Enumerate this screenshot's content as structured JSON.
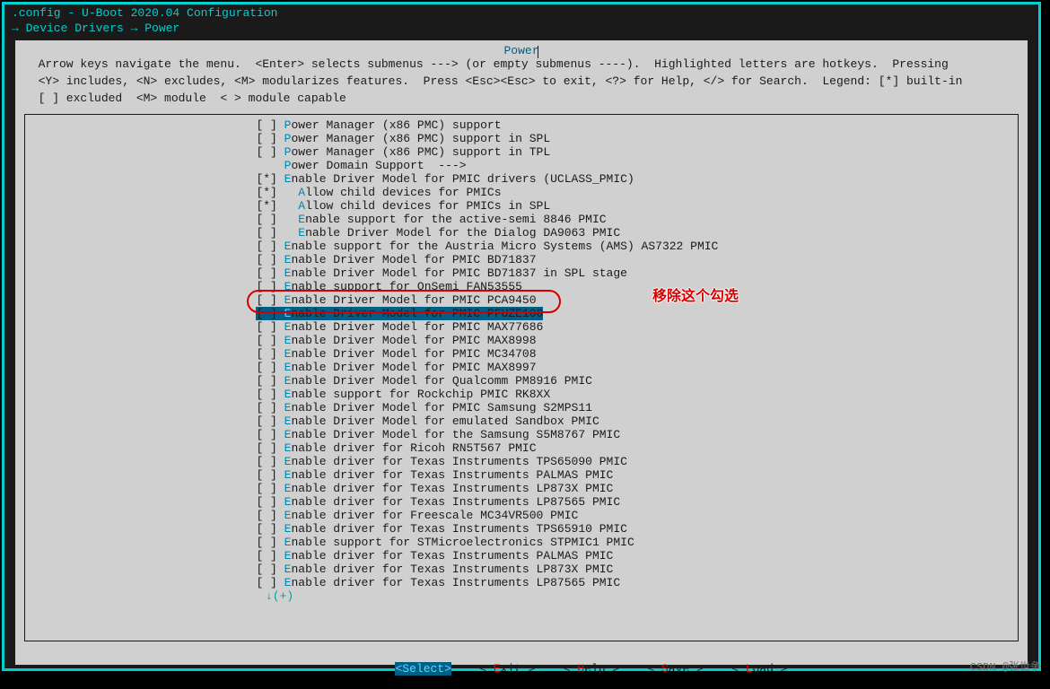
{
  "title": ".config - U-Boot 2020.04 Configuration",
  "breadcrumb": "→ Device Drivers → Power",
  "section_title": "Power",
  "help_lines": [
    "  Arrow keys navigate the menu.  <Enter> selects submenus ---> (or empty submenus ----).  Highlighted letters are hotkeys.  Pressing",
    "  <Y> includes, <N> excludes, <M> modularizes features.  Press <Esc><Esc> to exit, <?> for Help, </> for Search.  Legend: [*] built-in",
    "  [ ] excluded  <M> module  < > module capable"
  ],
  "pad": "                                 ",
  "items": [
    {
      "mark": "[ ]",
      "indent": 0,
      "hot": "P",
      "rest": "ower Manager (x86 PMC) support"
    },
    {
      "mark": "[ ]",
      "indent": 0,
      "hot": "P",
      "rest": "ower Manager (x86 PMC) support in SPL"
    },
    {
      "mark": "[ ]",
      "indent": 0,
      "hot": "P",
      "rest": "ower Manager (x86 PMC) support in TPL"
    },
    {
      "mark": "   ",
      "indent": 0,
      "hot": "P",
      "rest": "ower Domain Support  --->"
    },
    {
      "mark": "[*]",
      "indent": 0,
      "hot": "E",
      "rest": "nable Driver Model for PMIC drivers (UCLASS_PMIC)"
    },
    {
      "mark": "[*]",
      "indent": 1,
      "hot": "A",
      "rest": "llow child devices for PMICs"
    },
    {
      "mark": "[*]",
      "indent": 1,
      "hot": "A",
      "rest": "llow child devices for PMICs in SPL"
    },
    {
      "mark": "[ ]",
      "indent": 1,
      "hot": "E",
      "rest": "nable support for the active-semi 8846 PMIC"
    },
    {
      "mark": "[ ]",
      "indent": 1,
      "hot": "E",
      "rest": "nable Driver Model for the Dialog DA9063 PMIC"
    },
    {
      "mark": "[ ]",
      "indent": 0,
      "hot": "E",
      "rest": "nable support for the Austria Micro Systems (AMS) AS7322 PMIC"
    },
    {
      "mark": "[ ]",
      "indent": 0,
      "hot": "E",
      "rest": "nable Driver Model for PMIC BD71837"
    },
    {
      "mark": "[ ]",
      "indent": 0,
      "hot": "E",
      "rest": "nable Driver Model for PMIC BD71837 in SPL stage"
    },
    {
      "mark": "[ ]",
      "indent": 0,
      "hot": "E",
      "rest": "nable support for OnSemi FAN53555"
    },
    {
      "mark": "[ ]",
      "indent": 0,
      "hot": "E",
      "rest": "nable Driver Model for PMIC PCA9450"
    },
    {
      "mark": "[ ]",
      "indent": 0,
      "hot": "E",
      "rest": "nable Driver Model for PMIC PFUZE100",
      "selected": true
    },
    {
      "mark": "[ ]",
      "indent": 0,
      "hot": "E",
      "rest": "nable Driver Model for PMIC MAX77686"
    },
    {
      "mark": "[ ]",
      "indent": 0,
      "hot": "E",
      "rest": "nable Driver Model for PMIC MAX8998"
    },
    {
      "mark": "[ ]",
      "indent": 0,
      "hot": "E",
      "rest": "nable Driver Model for PMIC MC34708"
    },
    {
      "mark": "[ ]",
      "indent": 0,
      "hot": "E",
      "rest": "nable Driver Model for PMIC MAX8997"
    },
    {
      "mark": "[ ]",
      "indent": 0,
      "hot": "E",
      "rest": "nable Driver Model for Qualcomm PM8916 PMIC"
    },
    {
      "mark": "[ ]",
      "indent": 0,
      "hot": "E",
      "rest": "nable support for Rockchip PMIC RK8XX"
    },
    {
      "mark": "[ ]",
      "indent": 0,
      "hot": "E",
      "rest": "nable Driver Model for PMIC Samsung S2MPS11"
    },
    {
      "mark": "[ ]",
      "indent": 0,
      "hot": "E",
      "rest": "nable Driver Model for emulated Sandbox PMIC"
    },
    {
      "mark": "[ ]",
      "indent": 0,
      "hot": "E",
      "rest": "nable Driver Model for the Samsung S5M8767 PMIC"
    },
    {
      "mark": "[ ]",
      "indent": 0,
      "hot": "E",
      "rest": "nable driver for Ricoh RN5T567 PMIC"
    },
    {
      "mark": "[ ]",
      "indent": 0,
      "hot": "E",
      "rest": "nable driver for Texas Instruments TPS65090 PMIC"
    },
    {
      "mark": "[ ]",
      "indent": 0,
      "hot": "E",
      "rest": "nable driver for Texas Instruments PALMAS PMIC"
    },
    {
      "mark": "[ ]",
      "indent": 0,
      "hot": "E",
      "rest": "nable driver for Texas Instruments LP873X PMIC"
    },
    {
      "mark": "[ ]",
      "indent": 0,
      "hot": "E",
      "rest": "nable driver for Texas Instruments LP87565 PMIC"
    },
    {
      "mark": "[ ]",
      "indent": 0,
      "hot": "E",
      "rest": "nable driver for Freescale MC34VR500 PMIC"
    },
    {
      "mark": "[ ]",
      "indent": 0,
      "hot": "E",
      "rest": "nable driver for Texas Instruments TPS65910 PMIC"
    },
    {
      "mark": "[ ]",
      "indent": 0,
      "hot": "E",
      "rest": "nable support for STMicroelectronics STPMIC1 PMIC"
    },
    {
      "mark": "[ ]",
      "indent": 0,
      "hot": "E",
      "rest": "nable driver for Texas Instruments PALMAS PMIC"
    },
    {
      "mark": "[ ]",
      "indent": 0,
      "hot": "E",
      "rest": "nable driver for Texas Instruments LP873X PMIC"
    },
    {
      "mark": "[ ]",
      "indent": 0,
      "hot": "E",
      "rest": "nable driver for Texas Instruments LP87565 PMIC"
    }
  ],
  "more_indicator": "↓(+)",
  "annotation_text": "移除这个勾选",
  "buttons": {
    "select": "<Select>",
    "exit_pre": "< ",
    "exit_hot": "E",
    "exit_post": "xit >",
    "help_pre": "< ",
    "help_hot": "H",
    "help_post": "elp >",
    "save_pre": "< ",
    "save_hot": "S",
    "save_post": "ave >",
    "load_pre": "< ",
    "load_hot": "L",
    "load_post": "oad >"
  },
  "watermark": "CSDN @张世争"
}
